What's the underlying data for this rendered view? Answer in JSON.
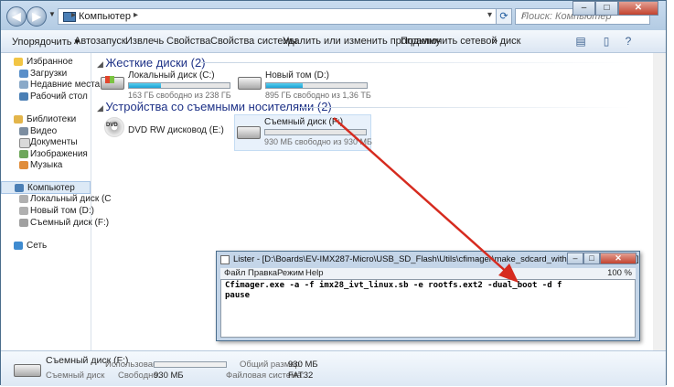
{
  "explorer": {
    "address": {
      "crumb": "Компьютер"
    },
    "search_placeholder": "Поиск: Компьютер",
    "window_controls": {
      "minimize": "–",
      "maximize": "□",
      "close": "✕"
    },
    "toolbar": [
      {
        "label": "Упорядочить ▾"
      },
      {
        "label": "Автозапуск"
      },
      {
        "label": "Извлечь"
      },
      {
        "label": "Свойства"
      },
      {
        "label": "Свойства системы"
      },
      {
        "label": "Удалить или изменить программу"
      },
      {
        "label": "Подключить сетевой диск"
      },
      {
        "label": "»"
      }
    ],
    "nav": {
      "favorites": {
        "title": "Избранное",
        "items": [
          "Загрузки",
          "Недавние места",
          "Рабочий стол"
        ]
      },
      "libraries": {
        "title": "Библиотеки",
        "items": [
          "Видео",
          "Документы",
          "Изображения",
          "Музыка"
        ]
      },
      "computer": {
        "title": "Компьютер",
        "items": [
          "Локальный диск (C",
          "Новый том (D:)",
          "Съемный диск (F:)"
        ]
      },
      "network": {
        "title": "Сеть"
      }
    },
    "groups": {
      "hard_drives": "Жесткие диски (2)",
      "removable": "Устройства со съемными носителями (2)"
    },
    "drives": [
      {
        "name": "Локальный диск (C:)",
        "free_text": "163 ГБ свободно из 238 ГБ",
        "used_fraction": 0.32
      },
      {
        "name": "Новый том (D:)",
        "free_text": "895 ГБ свободно из 1,36 ТБ",
        "used_fraction": 0.36
      },
      {
        "name": "DVD RW дисковод (E:)"
      },
      {
        "name": "Съемный диск (F:)",
        "free_text": "930 МБ свободно из 930 МБ",
        "used_fraction": 0.0
      }
    ],
    "details": {
      "name": "Съемный диск (F:)",
      "type": "Съемный диск",
      "used_label": "Использовано:",
      "free_label": "Свободно:",
      "free_value": "930 МБ",
      "total_label": "Общий размер:",
      "total_value": "930 МБ",
      "fs_label": "Файловая система:",
      "fs_value": "FAT32"
    }
  },
  "lister": {
    "title": "Lister - [D:\\Boards\\EV-IMX287-Micro\\USB_SD_Flash\\Utils\\cfimager\\make_sdcard_with_kernel_rootfs.bat]",
    "menu": [
      "Файл",
      "Правка",
      "Режим",
      "Help"
    ],
    "zoom": "100 %",
    "lines": [
      "Cfimager.exe -a -f imx28_ivt_linux.sb -e rootfs.ext2 -dual_boot -d f",
      "pause"
    ],
    "controls": {
      "minimize": "–",
      "maximize": "□",
      "close": "✕"
    }
  },
  "annotation": {
    "arrow_color": "#d62b1f"
  }
}
